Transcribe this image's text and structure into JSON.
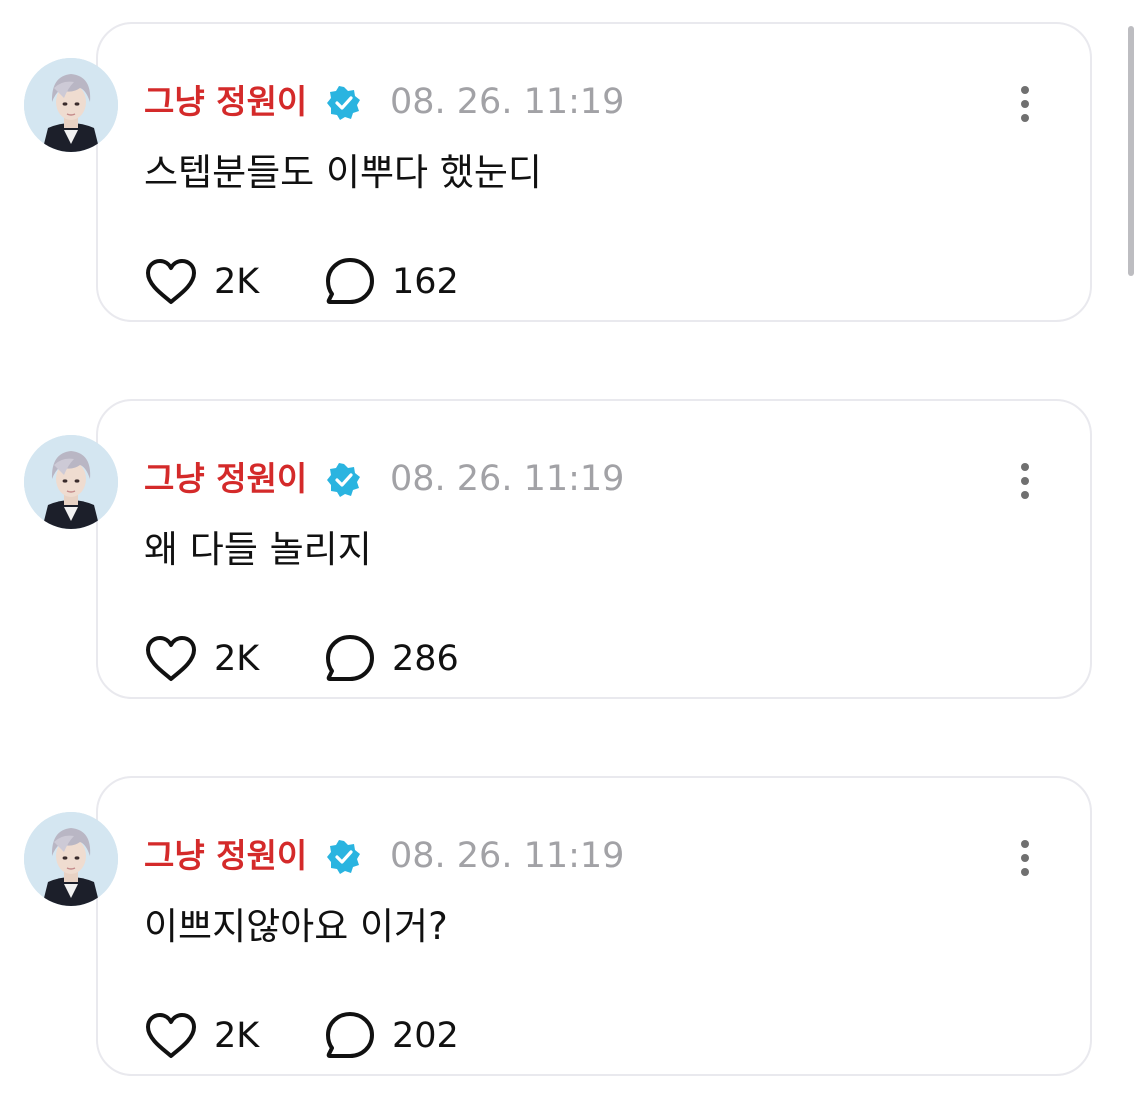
{
  "colors": {
    "name": "#d42a2a",
    "verified": "#2ab4e0",
    "timestamp": "#a2a2a6",
    "border": "#e9e9ee"
  },
  "posts": [
    {
      "author": "그냥 정원이",
      "verified_icon": "verified-badge-icon",
      "timestamp": "08. 26. 11:19",
      "text": "스텝분들도 이뿌다 했눈디",
      "likes": "2K",
      "replies": "162"
    },
    {
      "author": "그냥 정원이",
      "verified_icon": "verified-badge-icon",
      "timestamp": "08. 26. 11:19",
      "text": "왜 다들 놀리지",
      "likes": "2K",
      "replies": "286"
    },
    {
      "author": "그냥 정원이",
      "verified_icon": "verified-badge-icon",
      "timestamp": "08. 26. 11:19",
      "text": "이쁘지않아요 이거?",
      "likes": "2K",
      "replies": "202"
    }
  ]
}
